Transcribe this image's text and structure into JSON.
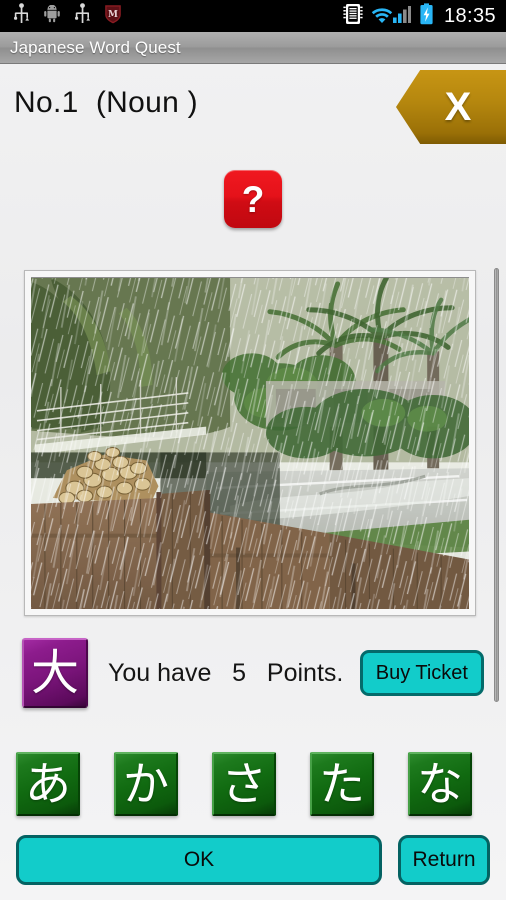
{
  "status_bar": {
    "time": "18:35",
    "left_icons": [
      {
        "name": "usb-icon",
        "glyph": "usb"
      },
      {
        "name": "android-robot-icon",
        "glyph": "android"
      },
      {
        "name": "usb-debug-icon",
        "glyph": "usb"
      },
      {
        "name": "mcafee-shield-icon",
        "glyph": "shield"
      }
    ],
    "right_icons": [
      {
        "name": "sd-card-icon",
        "glyph": "sdcard"
      },
      {
        "name": "wifi-signal-icon",
        "glyph": "wifi"
      },
      {
        "name": "battery-charging-icon",
        "glyph": "battery"
      }
    ]
  },
  "title_bar": {
    "app_title": "Japanese Word Quest"
  },
  "header": {
    "question_label": "No.1  (Noun )",
    "close_label": "X"
  },
  "hint": {
    "label": "?"
  },
  "photo": {
    "alt": "Heavy rain falling over a wooden fence, stacked logs, palm trees and a flooded road"
  },
  "points": {
    "kanji": "大",
    "text_before": "You have   ",
    "value": "5",
    "text_after": "   Points.",
    "full_text": "You have   5   Points.",
    "buy_ticket_label": "Buy Ticket"
  },
  "kana_buttons": [
    {
      "name": "kana-button-a",
      "label": "あ"
    },
    {
      "name": "kana-button-ka",
      "label": "か"
    },
    {
      "name": "kana-button-sa",
      "label": "さ"
    },
    {
      "name": "kana-button-ta",
      "label": "た"
    },
    {
      "name": "kana-button-na",
      "label": "な"
    }
  ],
  "bottom_bar": {
    "ok_label": "OK",
    "return_label": "Return"
  },
  "colors": {
    "accent_cyan": "#12ccca",
    "accent_cyan_border": "#046262",
    "kana_green": "#116b11",
    "kanji_purple": "#7c157c",
    "hint_red": "#e5121a",
    "close_gold": "#b4860e",
    "title_gray": "#9b9b9b",
    "page_bg": "#efeff0"
  }
}
